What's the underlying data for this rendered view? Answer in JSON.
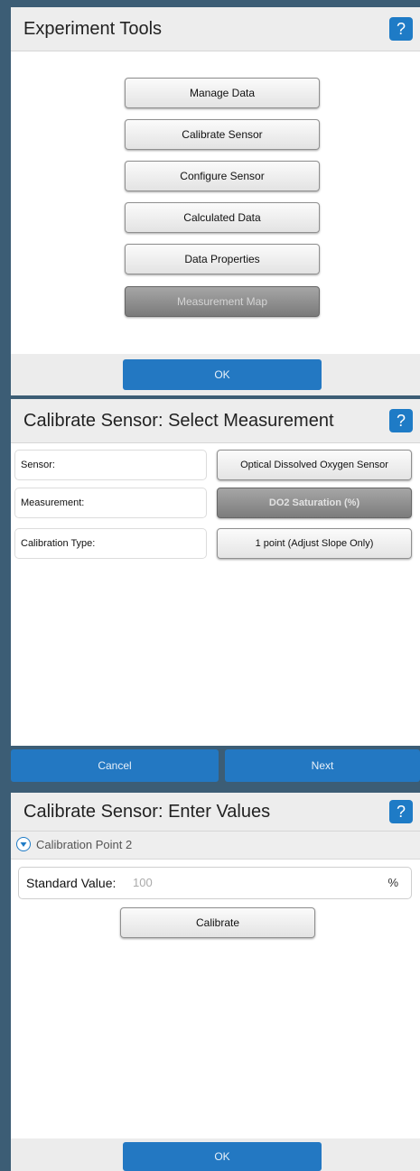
{
  "colors": {
    "accent": "#2378c2",
    "header_bg": "#ededed",
    "disabled": "#8a8a8a"
  },
  "icons": {
    "help": "help-icon",
    "expand": "expand-circle-icon"
  },
  "experiment_tools": {
    "title": "Experiment Tools",
    "help": "?",
    "buttons": [
      {
        "label": "Manage Data",
        "enabled": true
      },
      {
        "label": "Calibrate Sensor",
        "enabled": true
      },
      {
        "label": "Configure Sensor",
        "enabled": true
      },
      {
        "label": "Calculated Data",
        "enabled": true
      },
      {
        "label": "Data Properties",
        "enabled": true
      },
      {
        "label": "Measurement Map",
        "enabled": false
      }
    ],
    "ok": "OK"
  },
  "select_measurement": {
    "title": "Calibrate Sensor: Select Measurement",
    "help": "?",
    "rows": [
      {
        "label": "Sensor:",
        "value": "Optical Dissolved Oxygen Sensor",
        "enabled": true
      },
      {
        "label": "Measurement:",
        "value": "DO2 Saturation (%)",
        "enabled": false
      },
      {
        "label": "Calibration Type:",
        "value": "1 point (Adjust Slope Only)",
        "enabled": true
      }
    ],
    "cancel": "Cancel",
    "next": "Next"
  },
  "enter_values": {
    "title": "Calibrate Sensor: Enter Values",
    "help": "?",
    "section_label": "Calibration Point 2",
    "standard_value_label": "Standard Value:",
    "standard_value_placeholder": "100",
    "unit": "%",
    "calibrate": "Calibrate",
    "ok": "OK"
  }
}
